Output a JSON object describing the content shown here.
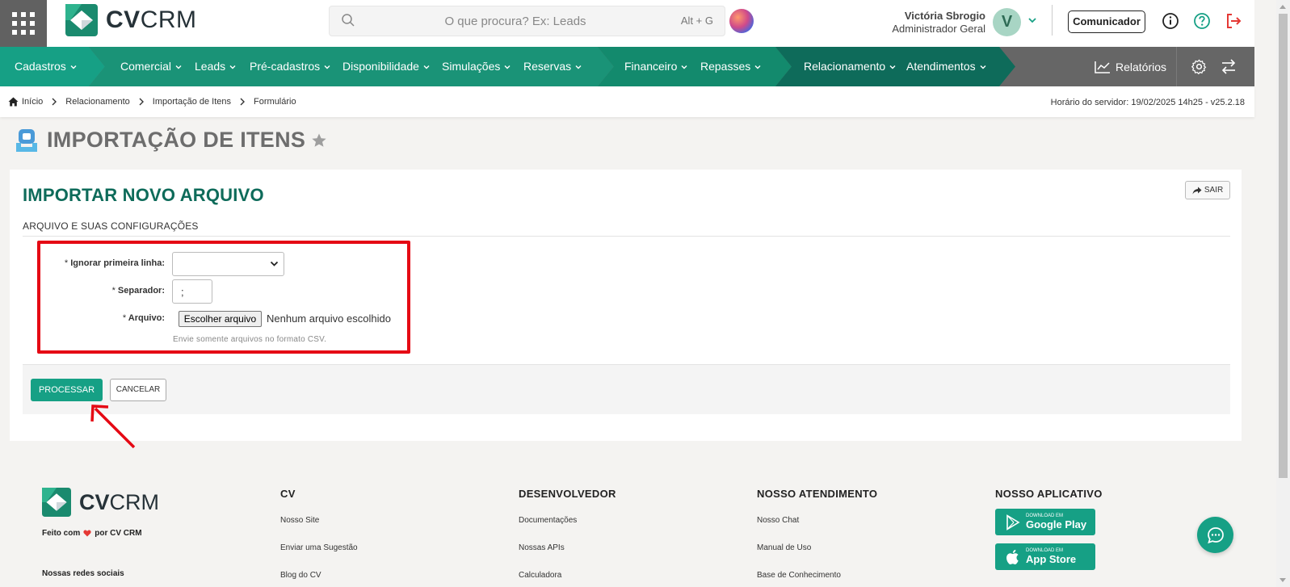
{
  "header": {
    "logo_text_bold": "CV",
    "logo_text_light": "CRM",
    "search_placeholder": "O que procura? Ex: Leads",
    "search_hint": "Alt + G",
    "user_name": "Victória Sbrogio",
    "user_role": "Administrador Geral",
    "avatar_initial": "V",
    "comunicador_label": "Comunicador"
  },
  "nav": {
    "items": [
      {
        "label": "Cadastros"
      },
      {
        "label": "Comercial"
      },
      {
        "label": "Leads"
      },
      {
        "label": "Pré-cadastros"
      },
      {
        "label": "Disponibilidade"
      },
      {
        "label": "Simulações"
      },
      {
        "label": "Reservas"
      },
      {
        "label": "Financeiro"
      },
      {
        "label": "Repasses"
      },
      {
        "label": "Relacionamento"
      },
      {
        "label": "Atendimentos"
      }
    ],
    "reports_label": "Relatórios"
  },
  "breadcrumb": {
    "items": [
      "Início",
      "Relacionamento",
      "Importação de Itens",
      "Formulário"
    ],
    "server_time": "Horário do servidor: 19/02/2025 14h25 - v25.2.18"
  },
  "page": {
    "title": "IMPORTAÇÃO DE ITENS"
  },
  "form": {
    "title": "IMPORTAR NOVO ARQUIVO",
    "sair_label": "SAIR",
    "section_label": "ARQUIVO E SUAS CONFIGURAÇÕES",
    "ignore_first_line_label": "Ignorar primeira linha:",
    "ignore_first_line_value": "",
    "separator_label": "Separador:",
    "separator_value": ";",
    "file_label": "Arquivo:",
    "required_mark": "*",
    "file_button": "Escolher arquivo",
    "file_none": "Nenhum arquivo escolhido",
    "file_help": "Envie somente arquivos no formato CSV.",
    "process_label": "PROCESSAR",
    "cancel_label": "CANCELAR"
  },
  "footer": {
    "made_prefix": "Feito com",
    "made_suffix": "por CV CRM",
    "social_label": "Nossas redes sociais",
    "columns": [
      {
        "title": "CV",
        "links": [
          "Nosso Site",
          "Enviar uma Sugestão",
          "Blog do CV"
        ]
      },
      {
        "title": "DESENVOLVEDOR",
        "links": [
          "Documentações",
          "Nossas APIs",
          "Calculadora"
        ]
      },
      {
        "title": "NOSSO ATENDIMENTO",
        "links": [
          "Nosso Chat",
          "Manual de Uso",
          "Base de Conhecimento"
        ]
      }
    ],
    "app_title": "NOSSO APLICATIVO",
    "google_play_small": "DOWNLOAD EM",
    "google_play_big": "Google Play",
    "app_store_small": "DOWNLOAD EM",
    "app_store_big": "App Store"
  },
  "colors": {
    "brand_green": "#16a085",
    "title_green": "#0e6b5a",
    "highlight_red": "#e50914"
  }
}
